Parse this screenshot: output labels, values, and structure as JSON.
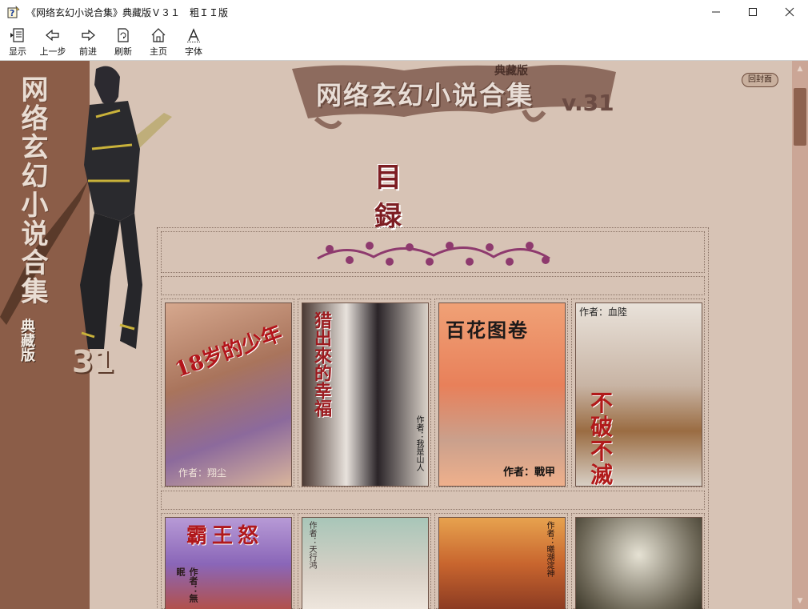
{
  "window": {
    "title": "《网络玄幻小说合集》典藏版Ｖ３１　粗ＩＩ版",
    "minimize": "—",
    "maximize": "☐",
    "close": "✕"
  },
  "toolbar": {
    "show": "显示",
    "back": "上一步",
    "forward": "前进",
    "refresh": "刷新",
    "home": "主页",
    "font": "字体"
  },
  "page": {
    "side_title": "网络玄幻小说合集",
    "side_edition": "典藏版",
    "side_number": "31",
    "banner_title": "网络玄幻小说合集",
    "banner_edition": "典藏版",
    "banner_version": "v.31",
    "back_cover": "回封面",
    "toc_heading": "目録",
    "accent_color": "#7d1d22"
  },
  "books": [
    {
      "title": "18岁的少年",
      "author": "作者：翔尘"
    },
    {
      "title": "猎出來的幸福",
      "author": "作者：我是山人"
    },
    {
      "title": "百花图卷",
      "author": "作者：戰甲"
    },
    {
      "title": "不破不滅",
      "author": "作者：血陸"
    },
    {
      "title": "霸王怒",
      "author": "作者：無眠"
    },
    {
      "title": "",
      "author": "作者：天行鸿"
    },
    {
      "title": "",
      "author": "作者：曦潮淀神"
    },
    {
      "title": "",
      "author": ""
    }
  ],
  "scrollbar": {
    "up": "▲",
    "down": "▼"
  }
}
